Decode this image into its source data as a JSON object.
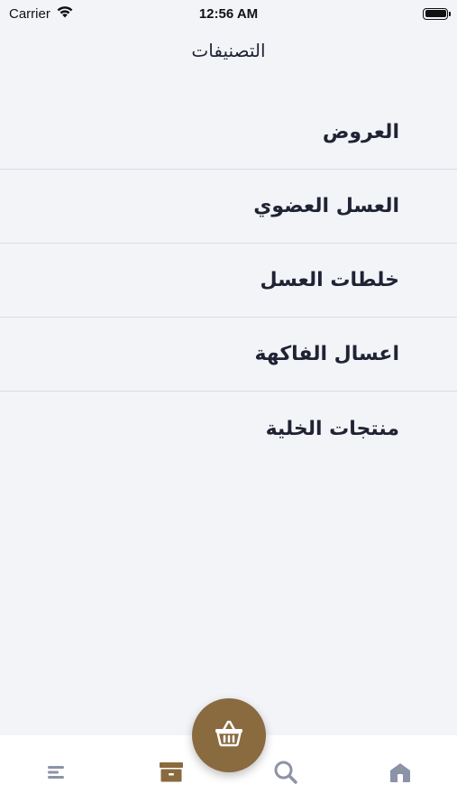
{
  "status_bar": {
    "carrier": "Carrier",
    "time": "12:56 AM"
  },
  "header": {
    "title": "التصنيفات"
  },
  "categories": [
    {
      "label": "العروض"
    },
    {
      "label": "العسل العضوي"
    },
    {
      "label": "خلطات العسل"
    },
    {
      "label": "اعسال الفاكهة"
    },
    {
      "label": "منتجات الخلية"
    }
  ],
  "tab_bar": {
    "tabs": [
      {
        "icon": "menu-icon"
      },
      {
        "icon": "archive-icon"
      },
      {
        "icon": "search-icon"
      },
      {
        "icon": "home-icon"
      }
    ],
    "fab_icon": "basket-icon"
  },
  "colors": {
    "background": "#f2f4f8",
    "accent": "#8a6a3f",
    "icon_inactive": "#8d93a6",
    "text": "#1f2333"
  }
}
